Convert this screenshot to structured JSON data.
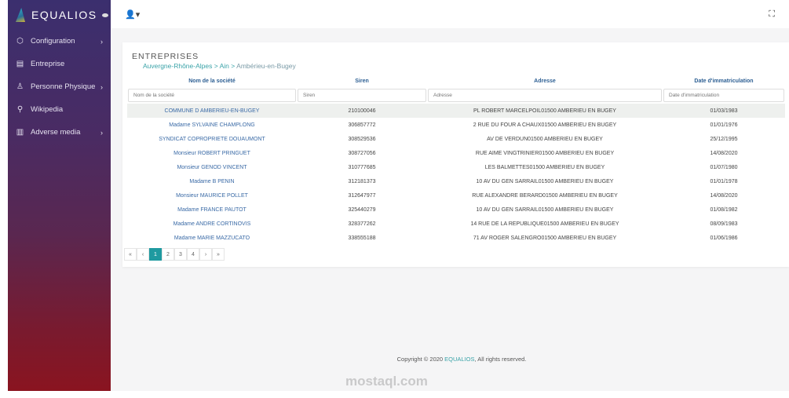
{
  "brand": "EQUALIOS",
  "sidebar": {
    "items": [
      {
        "label": "Configuration",
        "icon": "cube-icon",
        "chev": true
      },
      {
        "label": "Entreprise",
        "icon": "building-icon",
        "chev": false
      },
      {
        "label": "Personne Physique",
        "icon": "user-icon",
        "chev": true
      },
      {
        "label": "Wikipedia",
        "icon": "search-icon",
        "chev": false
      },
      {
        "label": "Adverse media",
        "icon": "book-icon",
        "chev": true
      }
    ]
  },
  "page": {
    "title": "ENTREPRISES",
    "breadcrumb": [
      "Auvergne-Rhône-Alpes",
      ">",
      "Ain",
      ">",
      "Ambérieu-en-Bugey"
    ]
  },
  "table": {
    "headers": [
      "Nom de la société",
      "Siren",
      "Adresse",
      "Date d'immatriculation"
    ],
    "placeholders": [
      "Nom de la société",
      "Siren",
      "Adresse",
      "Date d'immatriculation"
    ],
    "rows": [
      [
        "COMMUNE D AMBERIEU-EN-BUGEY",
        "210100046",
        "PL ROBERT MARCELPOIL01500 AMBERIEU EN BUGEY",
        "01/03/1983"
      ],
      [
        "Madame SYLVAINE CHAMPLONG",
        "306857772",
        "2 RUE DU FOUR A CHAUX01500 AMBERIEU EN BUGEY",
        "01/01/1976"
      ],
      [
        "SYNDICAT COPROPRIETE DOUAUMONT",
        "308529536",
        "AV DE VERDUN01500 AMBERIEU EN BUGEY",
        "25/12/1995"
      ],
      [
        "Monsieur ROBERT PRINGUET",
        "308727056",
        "RUE AIME VINGTRINIER01500 AMBERIEU EN BUGEY",
        "14/08/2020"
      ],
      [
        "Monsieur GENOD VINCENT",
        "310777685",
        "LES BALMETTES01500 AMBERIEU EN BUGEY",
        "01/07/1980"
      ],
      [
        "Madame B PENIN",
        "312181373",
        "10 AV DU GEN SARRAIL01500 AMBERIEU EN BUGEY",
        "01/01/1978"
      ],
      [
        "Monsieur MAURICE POLLET",
        "312647977",
        "RUE ALEXANDRE BERARD01500 AMBERIEU EN BUGEY",
        "14/08/2020"
      ],
      [
        "Madame FRANCE PAUTOT",
        "325440279",
        "10 AV DU GEN SARRAIL01500 AMBERIEU EN BUGEY",
        "01/08/1982"
      ],
      [
        "Madame ANDRE CORTINOVIS",
        "328377262",
        "14 RUE DE LA REPUBLIQUE01500 AMBERIEU EN BUGEY",
        "08/09/1983"
      ],
      [
        "Madame MARIE MAZZUCATO",
        "338555188",
        "71 AV ROGER SALENGRO01500 AMBERIEU EN BUGEY",
        "01/06/1986"
      ]
    ]
  },
  "pagination": {
    "items": [
      "«",
      "‹",
      "1",
      "2",
      "3",
      "4",
      "›",
      "»"
    ],
    "current": "1"
  },
  "footer": {
    "prefix": "Copyright © 2020 ",
    "brand": "EQUALIOS",
    "suffix": ", All rights reserved."
  },
  "watermark": "mostaql.com",
  "colors": {
    "accent": "#1f9aa0",
    "link": "#3a6aa6"
  }
}
